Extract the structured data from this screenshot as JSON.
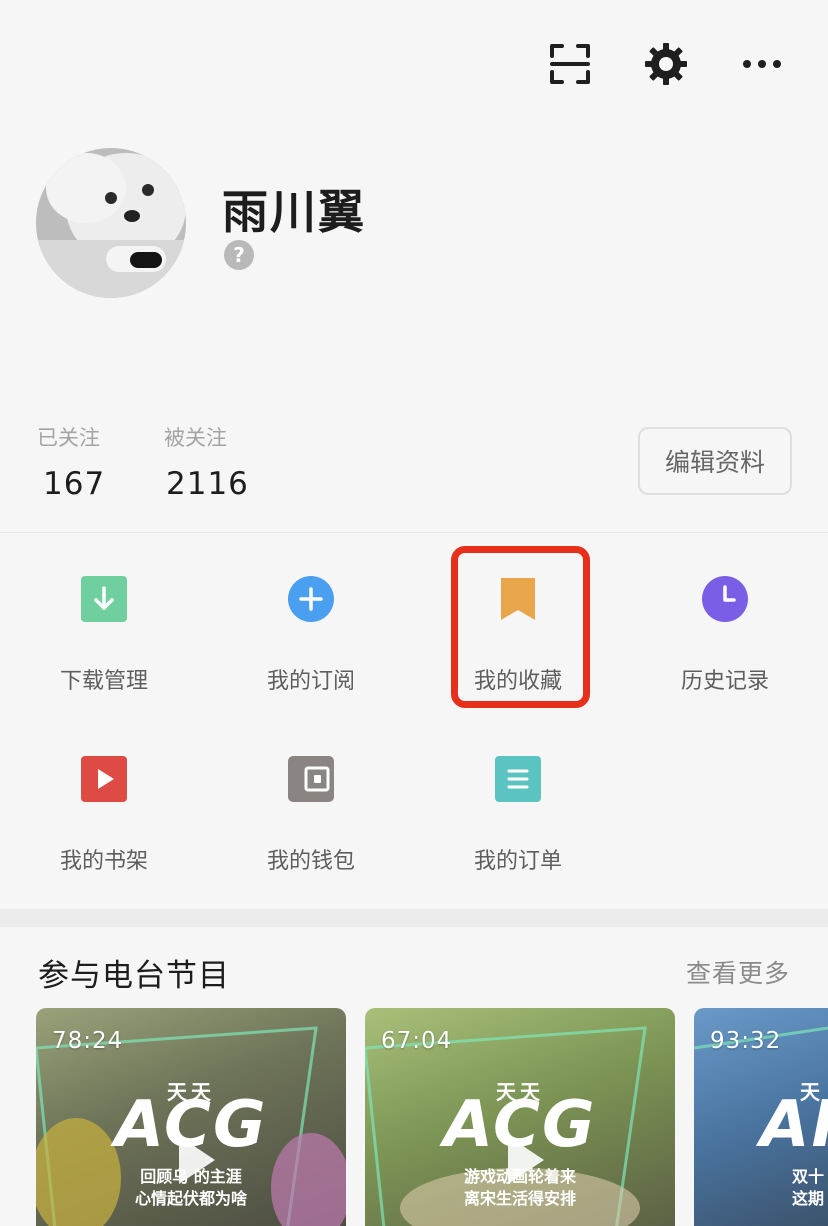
{
  "profile": {
    "username": "雨川翼",
    "help_symbol": "?"
  },
  "stats": {
    "following_label": "已关注",
    "following_count": "167",
    "followers_label": "被关注",
    "followers_count": "2116"
  },
  "edit_profile_label": "编辑资料",
  "grid": {
    "download": "下载管理",
    "subscribe": "我的订阅",
    "favorites": "我的收藏",
    "history": "历史记录",
    "bookshelf": "我的书架",
    "wallet": "我的钱包",
    "orders": "我的订单"
  },
  "section": {
    "title": "参与电台节目",
    "more": "查看更多"
  },
  "cards": [
    {
      "duration": "78:24",
      "brand_top": "天天",
      "brand": "ACG",
      "subtitle_1": "回顾乌 的主涯",
      "subtitle_2": "心情起伏都为啥"
    },
    {
      "duration": "67:04",
      "brand_top": "天天",
      "brand": "ACG",
      "subtitle_1": "游戏动画轮着来",
      "subtitle_2": "离宋生活得安排"
    },
    {
      "duration": "93:32",
      "brand_top": "天",
      "brand": "AI",
      "subtitle_1": "双十",
      "subtitle_2": "这期"
    }
  ],
  "colors": {
    "download_icon": "#6fcf9f",
    "subscribe_icon": "#4a9ff0",
    "favorites_icon": "#e9a54a",
    "history_icon": "#7b5ee6",
    "bookshelf_icon": "#de4a44",
    "wallet_icon": "#8a8582",
    "orders_icon": "#5cc4c0",
    "highlight": "#e6301b"
  }
}
